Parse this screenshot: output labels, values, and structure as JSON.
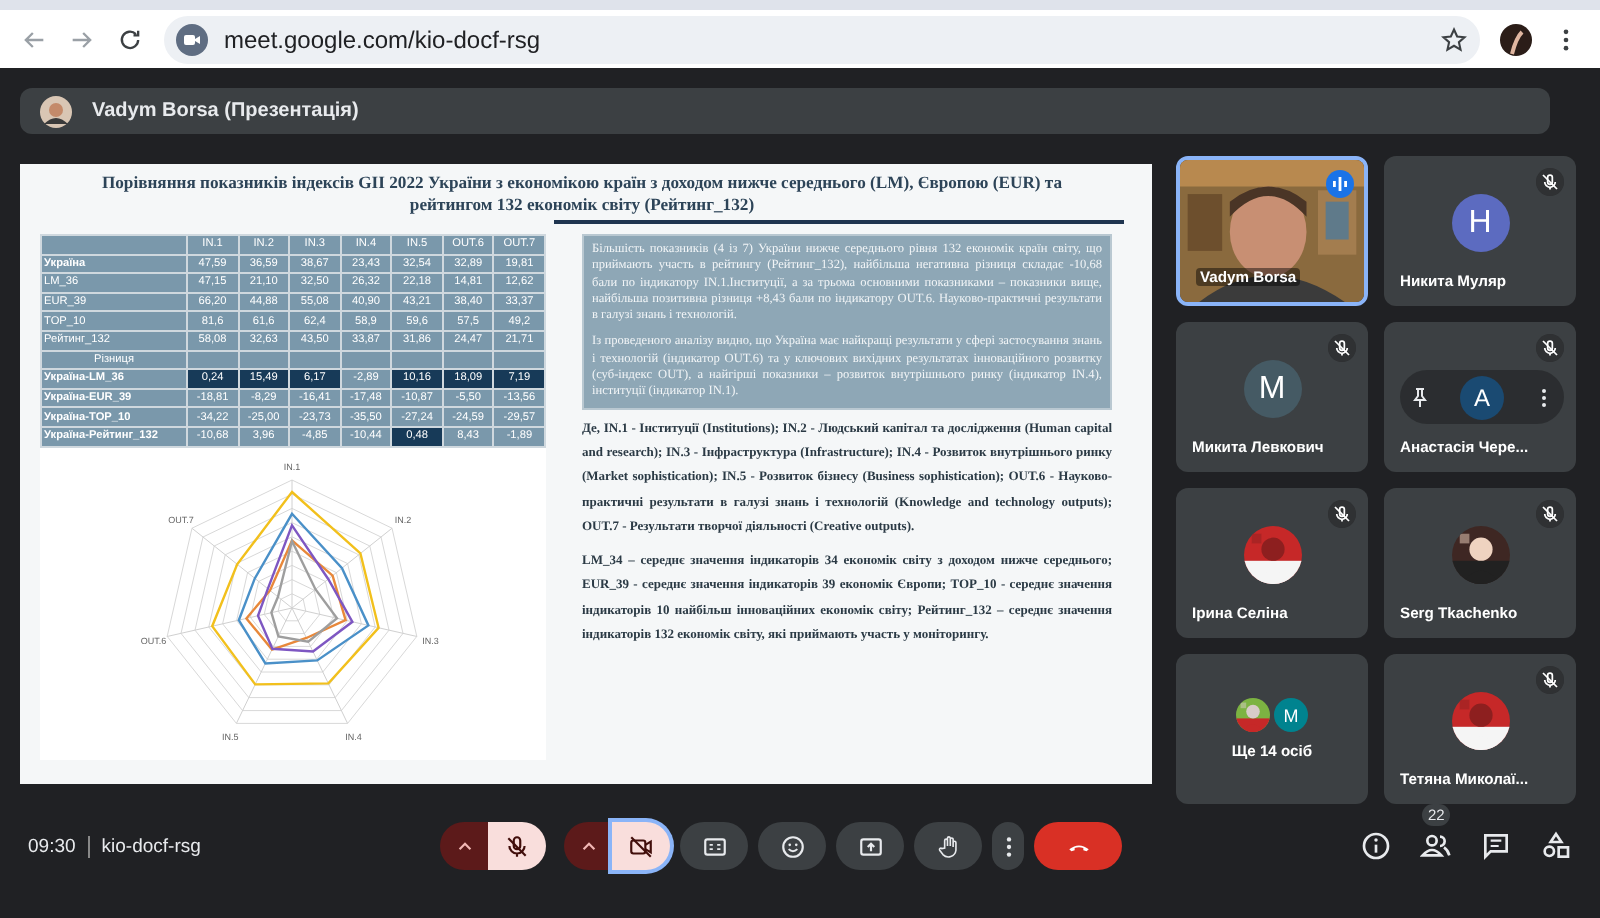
{
  "browser": {
    "url": "meet.google.com/kio-docf-rsg"
  },
  "presenter": {
    "label": "Vadym Borsa (Презентація)"
  },
  "slide": {
    "title": "Порівняння показників індексів GII 2022 України з економікою країн з доходом нижче середнього (LM), Європою (EUR) та рейтингом 132 економік світу (Рейтинг_132)",
    "table": {
      "columns": [
        "IN.1",
        "IN.2",
        "IN.3",
        "IN.4",
        "IN.5",
        "OUT.6",
        "OUT.7"
      ],
      "rows": [
        {
          "kind": "values",
          "label": "Україна",
          "cells": [
            {
              "text": "47,59",
              "highlighted": false
            },
            {
              "text": "36,59",
              "highlighted": false
            },
            {
              "text": "38,67",
              "highlighted": false
            },
            {
              "text": "23,43",
              "highlighted": false
            },
            {
              "text": "32,54",
              "highlighted": false
            },
            {
              "text": "32,89",
              "highlighted": false
            },
            {
              "text": "19,81",
              "highlighted": false
            }
          ]
        },
        {
          "kind": "values",
          "label": "LM_36",
          "cells": [
            {
              "text": "47,15",
              "highlighted": false
            },
            {
              "text": "21,10",
              "highlighted": false
            },
            {
              "text": "32,50",
              "highlighted": false
            },
            {
              "text": "26,32",
              "highlighted": false
            },
            {
              "text": "22,18",
              "highlighted": false
            },
            {
              "text": "14,81",
              "highlighted": false
            },
            {
              "text": "12,62",
              "highlighted": false
            }
          ]
        },
        {
          "kind": "values",
          "label": "EUR_39",
          "cells": [
            {
              "text": "66,20",
              "highlighted": false
            },
            {
              "text": "44,88",
              "highlighted": false
            },
            {
              "text": "55,08",
              "highlighted": false
            },
            {
              "text": "40,90",
              "highlighted": false
            },
            {
              "text": "43,21",
              "highlighted": false
            },
            {
              "text": "38,40",
              "highlighted": false
            },
            {
              "text": "33,37",
              "highlighted": false
            }
          ]
        },
        {
          "kind": "values",
          "label": "TOP_10",
          "cells": [
            {
              "text": "81,6",
              "highlighted": false
            },
            {
              "text": "61,6",
              "highlighted": false
            },
            {
              "text": "62,4",
              "highlighted": false
            },
            {
              "text": "58,9",
              "highlighted": false
            },
            {
              "text": "59,6",
              "highlighted": false
            },
            {
              "text": "57,5",
              "highlighted": false
            },
            {
              "text": "49,2",
              "highlighted": false
            }
          ]
        },
        {
          "kind": "values",
          "label": "Рейтинг_132",
          "cells": [
            {
              "text": "58,08",
              "highlighted": false
            },
            {
              "text": "32,63",
              "highlighted": false
            },
            {
              "text": "43,50",
              "highlighted": false
            },
            {
              "text": "33,87",
              "highlighted": false
            },
            {
              "text": "31,86",
              "highlighted": false
            },
            {
              "text": "24,47",
              "highlighted": false
            },
            {
              "text": "21,71",
              "highlighted": false
            }
          ]
        },
        {
          "kind": "section",
          "label": "Різниця"
        },
        {
          "kind": "values",
          "label": "Україна-LM_36",
          "cells": [
            {
              "text": "0,24",
              "highlighted": true
            },
            {
              "text": "15,49",
              "highlighted": true
            },
            {
              "text": "6,17",
              "highlighted": true
            },
            {
              "text": "-2,89",
              "highlighted": false
            },
            {
              "text": "10,16",
              "highlighted": true
            },
            {
              "text": "18,09",
              "highlighted": true
            },
            {
              "text": "7,19",
              "highlighted": true
            }
          ]
        },
        {
          "kind": "values",
          "label": "Україна-EUR_39",
          "cells": [
            {
              "text": "-18,81",
              "highlighted": false
            },
            {
              "text": "-8,29",
              "highlighted": false
            },
            {
              "text": "-16,41",
              "highlighted": false
            },
            {
              "text": "-17,48",
              "highlighted": false
            },
            {
              "text": "-10,87",
              "highlighted": false
            },
            {
              "text": "-5,50",
              "highlighted": false
            },
            {
              "text": "-13,56",
              "highlighted": false
            }
          ]
        },
        {
          "kind": "values",
          "label": "Україна-TOP_10",
          "cells": [
            {
              "text": "-34,22",
              "highlighted": false
            },
            {
              "text": "-25,00",
              "highlighted": false
            },
            {
              "text": "-23,73",
              "highlighted": false
            },
            {
              "text": "-35,50",
              "highlighted": false
            },
            {
              "text": "-27,24",
              "highlighted": false
            },
            {
              "text": "-24,59",
              "highlighted": false
            },
            {
              "text": "-29,57",
              "highlighted": false
            }
          ]
        },
        {
          "kind": "values",
          "label": "Україна-Рейтинг_132",
          "cells": [
            {
              "text": "-10,68",
              "highlighted": false
            },
            {
              "text": "3,96",
              "highlighted": false
            },
            {
              "text": "-4,85",
              "highlighted": false
            },
            {
              "text": "-10,44",
              "highlighted": false
            },
            {
              "text": "0,48",
              "highlighted": true
            },
            {
              "text": "8,43",
              "highlighted": false
            },
            {
              "text": "-1,89",
              "highlighted": false
            }
          ]
        }
      ]
    },
    "radar_axes": [
      "IN.1",
      "IN.2",
      "IN.3",
      "IN.4",
      "IN.5",
      "OUT.6",
      "OUT.7"
    ],
    "summary": [
      "Більшість показників (4 із 7) України нижче середнього рівня 132 економік країн світу, що приймають участь в рейтингу (Рейтинг_132), найбільша негативна різниця складає -10,68 бали по індикатору IN.1.Інституції, а за трьома основними показниками – показники вище, найбільша позитивна різниця +8,43 бали по індикатору OUT.6. Науково-практичні результати в галузі знань і технологій.",
      "Із проведеного аналізу видно, що Україна має найкращі результати у сфері застосування знань і технологій (індикатор OUT.6) та у ключових вихідних результатах інноваційного розвитку (суб-індекс OUT), а найгірші показники – розвиток внутрішнього ринку (індикатор IN.4), інституції (індикатор IN.1)."
    ],
    "notes": [
      "Де, IN.1 - Інституції (Institutions); IN.2 - Людський капітал та дослідження (Human capital and research); IN.3 - Інфраструктура (Infrastructure); IN.4 - Розвиток внутрішнього ринку (Market sophistication); IN.5 - Розвиток бізнесу (Business sophistication); OUT.6 - Науково-практичні результати в галузі знань і технологій (Knowledge and technology outputs); OUT.7 - Результати творчої діяльності (Creative outputs).",
      "LM_34 – середнє значення індикаторів 34 економік світу з доходом нижче середнього; EUR_39 - середнє значення індикаторів 39 економік Європи; TOP_10 - середнє значення індикаторів 10 найбільш інноваційних економік світу; Рейтинг_132 – середнє значення індикаторів 132 економік світу, які приймають участь у моніторингу."
    ]
  },
  "participants": [
    {
      "kind": "video",
      "name": "Vadym Borsa",
      "muted": false,
      "speaking": true,
      "hovered": false
    },
    {
      "kind": "letter",
      "name": "Никита Муляр",
      "letter": "Н",
      "color": "#5c6bc0",
      "muted": true,
      "speaking": false,
      "hovered": false
    },
    {
      "kind": "letter",
      "name": "Микита Левкович",
      "letter": "M",
      "color": "#455a64",
      "muted": true,
      "speaking": false,
      "hovered": false
    },
    {
      "kind": "letter",
      "name": "Анастасія Чере...",
      "letter": "A",
      "color": "#1a4a72",
      "muted": true,
      "speaking": false,
      "hovered": true
    },
    {
      "name": "Ірина Селіна",
      "muted": true,
      "speaking": false,
      "hovered": false
    },
    {
      "name": "Serg Tkachenko",
      "muted": true,
      "speaking": false,
      "hovered": false
    },
    {
      "kind": "more",
      "name": "Ще 14 осіб",
      "letter": "M",
      "color": "#00838f",
      "muted": false,
      "speaking": false,
      "hovered": false
    },
    {
      "name": "Тетяна Миколаї...",
      "muted": true,
      "speaking": false,
      "hovered": false
    }
  ],
  "call": {
    "time": "09:30",
    "code": "kio-docf-rsg",
    "microphone_on": false,
    "camera_on": false,
    "people_count": "22"
  }
}
